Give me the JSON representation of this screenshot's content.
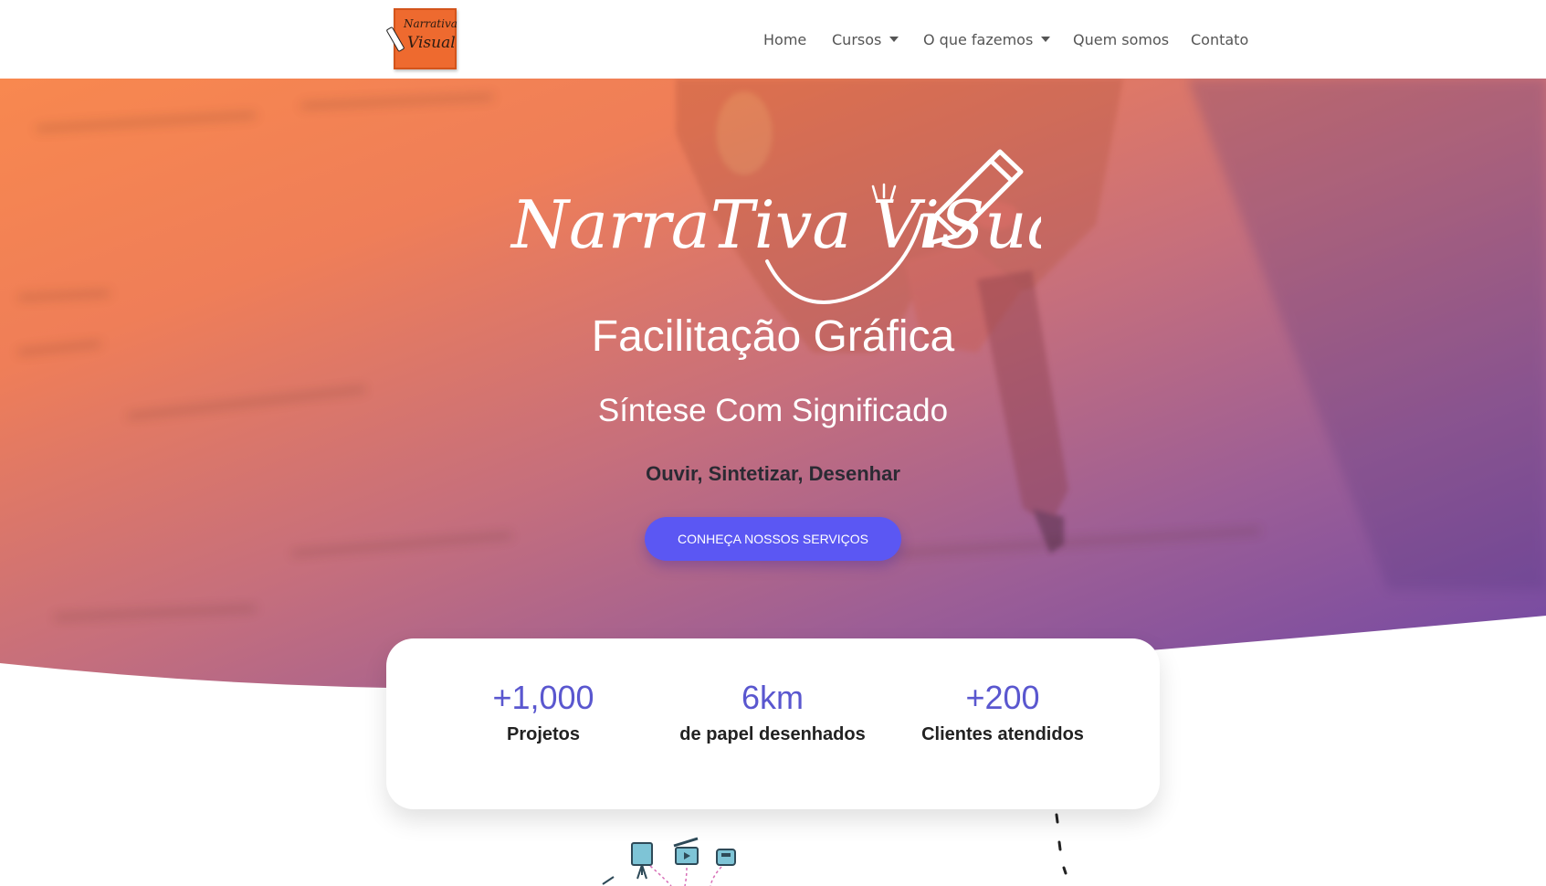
{
  "header": {
    "logo_top": "Narrativa",
    "logo_bottom": "Visual",
    "nav": {
      "home": "Home",
      "cursos": "Cursos",
      "o_que_fazemos": "O que fazemos",
      "quem_somos": "Quem somos",
      "contato": "Contato"
    }
  },
  "hero": {
    "wordmark": "NarraTiva ViSual",
    "title": "Facilitação Gráfica",
    "subtitle": "Síntese Com Significado",
    "tagline": "Ouvir, Sintetizar, Desenhar",
    "cta_label": "CONHEÇA NOSSOS SERVIÇOS"
  },
  "stats": [
    {
      "value": "+1,000",
      "label": "Projetos"
    },
    {
      "value": "6km",
      "label": "de papel desenhados"
    },
    {
      "value": "+200",
      "label": "Clientes atendidos"
    }
  ],
  "colors": {
    "accent": "#5b57f3",
    "stat_number": "#5a57cf",
    "gradient_start": "#f8884f",
    "gradient_end": "#6b45a6",
    "logo_orange": "#ee6a2f"
  }
}
